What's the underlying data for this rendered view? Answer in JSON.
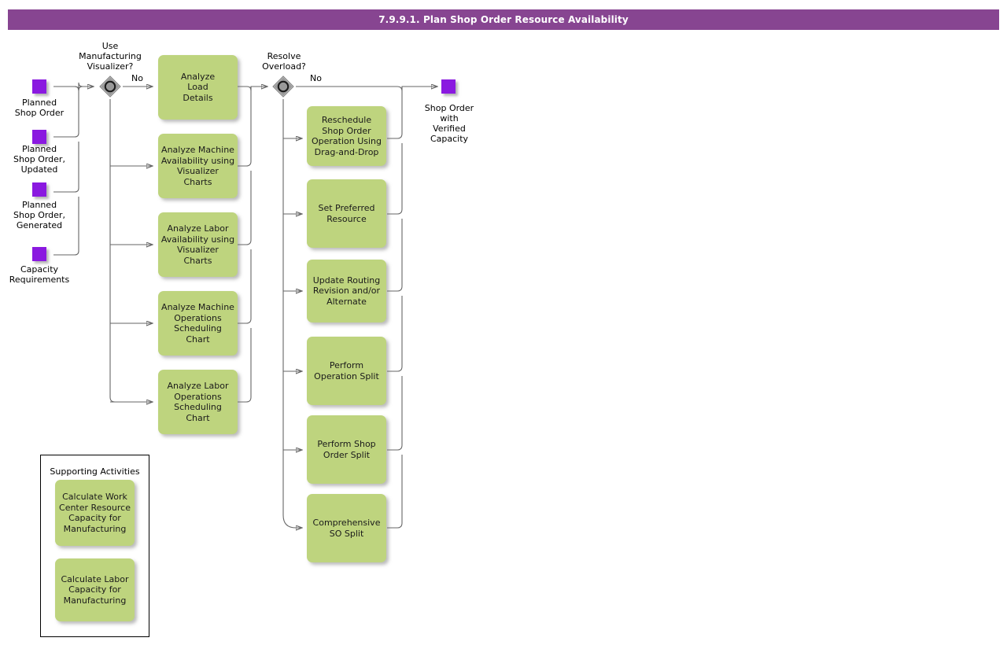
{
  "header": {
    "title": "7.9.9.1. Plan Shop Order Resource Availability",
    "bar_color": "#874591",
    "text_color": "#ffffff"
  },
  "palette": {
    "task_fill": "#BED47E",
    "data_object_fill": "#8A19E0",
    "gateway_fill": "#999999",
    "connector": "#666666"
  },
  "inputs": [
    {
      "name": "planned-shop-order",
      "label": "Planned\nShop Order"
    },
    {
      "name": "planned-shop-order-updated",
      "label": "Planned\nShop Order,\nUpdated"
    },
    {
      "name": "planned-shop-order-generated",
      "label": "Planned\nShop Order,\nGenerated"
    },
    {
      "name": "capacity-requirements",
      "label": "Capacity\nRequirements"
    }
  ],
  "gateways": [
    {
      "name": "use-manufacturing-visualizer",
      "label": "Use\nManufacturing\nVisualizer?",
      "branch_label": "No"
    },
    {
      "name": "resolve-overload",
      "label": "Resolve\nOverload?",
      "branch_label": "No"
    }
  ],
  "visualizer_tasks": [
    {
      "name": "analyze-load-details",
      "label": "Analyze\nLoad\nDetails"
    },
    {
      "name": "analyze-machine-availability-visualizer-charts",
      "label": "Analyze Machine\nAvailability using\nVisualizer\nCharts"
    },
    {
      "name": "analyze-labor-availability-visualizer-charts",
      "label": "Analyze Labor\nAvailability using\nVisualizer\nCharts"
    },
    {
      "name": "analyze-machine-operations-scheduling-chart",
      "label": "Analyze Machine\nOperations\nScheduling\nChart"
    },
    {
      "name": "analyze-labor-operations-scheduling-chart",
      "label": "Analyze Labor\nOperations\nScheduling\nChart"
    }
  ],
  "overload_tasks": [
    {
      "name": "reschedule-shop-order-operation-drag-and-drop",
      "label": "Reschedule\nShop Order\nOperation Using\nDrag-and-Drop"
    },
    {
      "name": "set-preferred-resource",
      "label": "Set Preferred\nResource"
    },
    {
      "name": "update-routing-revision-alternate",
      "label": "Update Routing\nRevision and/or\nAlternate"
    },
    {
      "name": "perform-operation-split",
      "label": "Perform\nOperation Split"
    },
    {
      "name": "perform-shop-order-split",
      "label": "Perform Shop\nOrder Split"
    },
    {
      "name": "comprehensive-so-split",
      "label": "Comprehensive\nSO Split"
    }
  ],
  "output": {
    "name": "shop-order-with-verified-capacity",
    "label": "Shop Order\nwith\nVerified\nCapacity"
  },
  "supporting": {
    "title": "Supporting Activities",
    "tasks": [
      {
        "name": "calculate-work-center-resource-capacity-for-manufacturing",
        "label": "Calculate Work\nCenter Resource\nCapacity for\nManufacturing"
      },
      {
        "name": "calculate-labor-capacity-for-manufacturing",
        "label": "Calculate Labor\nCapacity for\nManufacturing"
      }
    ]
  }
}
